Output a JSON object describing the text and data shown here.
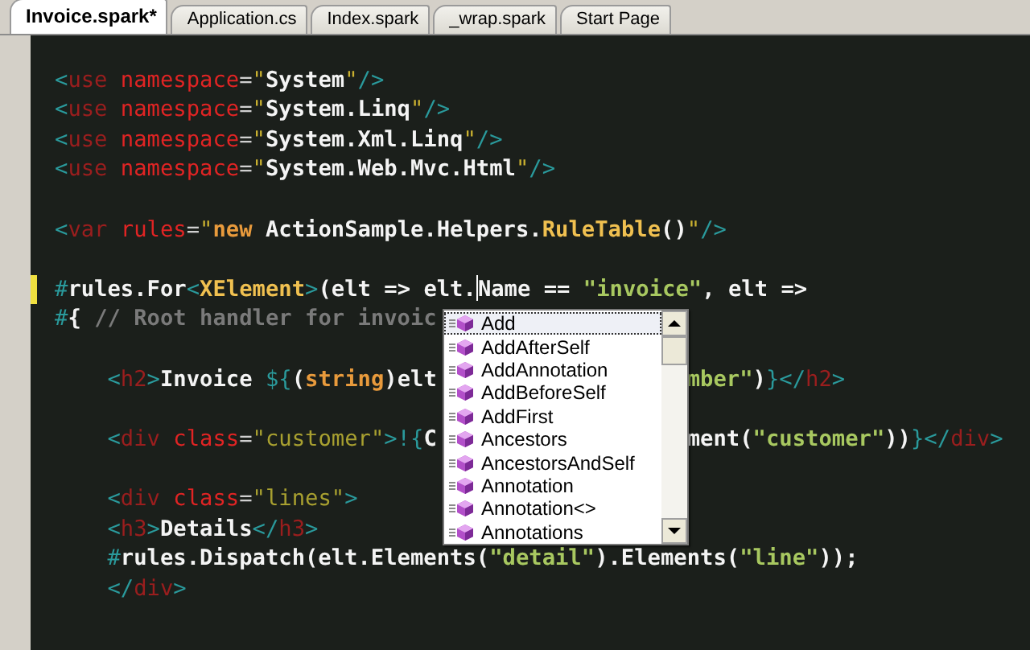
{
  "tabs": [
    {
      "label": "Invoice.spark*",
      "selected": true
    },
    {
      "label": "Application.cs",
      "selected": false
    },
    {
      "label": "Index.spark",
      "selected": false
    },
    {
      "label": "_wrap.spark",
      "selected": false
    },
    {
      "label": "Start Page",
      "selected": false
    }
  ],
  "editor": {
    "blocks": [
      [
        {
          "tokens": [
            {
              "kind": "punct",
              "text": "<"
            },
            {
              "kind": "tag",
              "text": "use"
            },
            {
              "kind": "attr",
              "text": " namespace"
            },
            {
              "kind": "op",
              "text": "="
            },
            {
              "kind": "quote",
              "text": "\""
            },
            {
              "kind": "text",
              "text": "System"
            },
            {
              "kind": "quote",
              "text": "\""
            },
            {
              "kind": "punct",
              "text": "/>"
            }
          ]
        },
        {
          "tokens": [
            {
              "kind": "punct",
              "text": "<"
            },
            {
              "kind": "tag",
              "text": "use"
            },
            {
              "kind": "attr",
              "text": " namespace"
            },
            {
              "kind": "op",
              "text": "="
            },
            {
              "kind": "quote",
              "text": "\""
            },
            {
              "kind": "text",
              "text": "System.Linq"
            },
            {
              "kind": "quote",
              "text": "\""
            },
            {
              "kind": "punct",
              "text": "/>"
            }
          ]
        },
        {
          "tokens": [
            {
              "kind": "punct",
              "text": "<"
            },
            {
              "kind": "tag",
              "text": "use"
            },
            {
              "kind": "attr",
              "text": " namespace"
            },
            {
              "kind": "op",
              "text": "="
            },
            {
              "kind": "quote",
              "text": "\""
            },
            {
              "kind": "text",
              "text": "System.Xml.Linq"
            },
            {
              "kind": "quote",
              "text": "\""
            },
            {
              "kind": "punct",
              "text": "/>"
            }
          ]
        },
        {
          "tokens": [
            {
              "kind": "punct",
              "text": "<"
            },
            {
              "kind": "tag",
              "text": "use"
            },
            {
              "kind": "attr",
              "text": " namespace"
            },
            {
              "kind": "op",
              "text": "="
            },
            {
              "kind": "quote",
              "text": "\""
            },
            {
              "kind": "text",
              "text": "System.Web.Mvc.Html"
            },
            {
              "kind": "quote",
              "text": "\""
            },
            {
              "kind": "punct",
              "text": "/>"
            }
          ]
        }
      ],
      [
        {
          "tokens": [
            {
              "kind": "punct",
              "text": "<"
            },
            {
              "kind": "tag",
              "text": "var"
            },
            {
              "kind": "attr",
              "text": " rules"
            },
            {
              "kind": "op",
              "text": "="
            },
            {
              "kind": "quote",
              "text": "\""
            },
            {
              "kind": "keyword",
              "text": "new"
            },
            {
              "kind": "text",
              "text": " ActionSample.Helpers."
            },
            {
              "kind": "type",
              "text": "RuleTable"
            },
            {
              "kind": "text",
              "text": "()"
            },
            {
              "kind": "quote",
              "text": "\""
            },
            {
              "kind": "punct",
              "text": "/>"
            }
          ]
        }
      ],
      [
        {
          "modified": true,
          "tokens": [
            {
              "kind": "punct",
              "text": "#"
            },
            {
              "kind": "text",
              "text": "rules.For"
            },
            {
              "kind": "punct",
              "text": "<"
            },
            {
              "kind": "type",
              "text": "XElement"
            },
            {
              "kind": "punct",
              "text": ">"
            },
            {
              "kind": "text",
              "text": "(elt => elt."
            },
            {
              "kind": "caret"
            },
            {
              "kind": "text",
              "text": "Name == "
            },
            {
              "kind": "string",
              "text": "\"invoice\""
            },
            {
              "kind": "text",
              "text": ", elt =>"
            }
          ]
        },
        {
          "tokens": [
            {
              "kind": "punct",
              "text": "#"
            },
            {
              "kind": "text",
              "text": "{ "
            },
            {
              "kind": "comment",
              "text": "// Root handler for invoic"
            }
          ]
        }
      ],
      [
        {
          "indent": true,
          "tokens": [
            {
              "kind": "punct",
              "text": "<"
            },
            {
              "kind": "tag",
              "text": "h2"
            },
            {
              "kind": "punct",
              "text": ">"
            },
            {
              "kind": "text",
              "text": "Invoice "
            },
            {
              "kind": "punct",
              "text": "${"
            },
            {
              "kind": "text",
              "text": "("
            },
            {
              "kind": "keyword",
              "text": "string"
            },
            {
              "kind": "text",
              "text": ")elt"
            }
          ],
          "after_popup": [
            {
              "kind": "string",
              "text": "mber\""
            },
            {
              "kind": "text",
              "text": ")"
            },
            {
              "kind": "punct",
              "text": "}</"
            },
            {
              "kind": "tag",
              "text": "h2"
            },
            {
              "kind": "punct",
              "text": ">"
            }
          ]
        }
      ],
      [
        {
          "indent": true,
          "tokens": [
            {
              "kind": "punct",
              "text": "<"
            },
            {
              "kind": "tag",
              "text": "div"
            },
            {
              "kind": "attr",
              "text": " class"
            },
            {
              "kind": "op",
              "text": "="
            },
            {
              "kind": "value",
              "text": "\"customer\""
            },
            {
              "kind": "punct",
              "text": ">!{"
            },
            {
              "kind": "text",
              "text": "C"
            }
          ],
          "after_popup": [
            {
              "kind": "text",
              "text": "ment("
            },
            {
              "kind": "string",
              "text": "\"customer\""
            },
            {
              "kind": "text",
              "text": "))"
            },
            {
              "kind": "punct",
              "text": "}</"
            },
            {
              "kind": "tag",
              "text": "div"
            },
            {
              "kind": "punct",
              "text": ">"
            }
          ]
        }
      ],
      [
        {
          "indent": true,
          "tokens": [
            {
              "kind": "punct",
              "text": "<"
            },
            {
              "kind": "tag",
              "text": "div"
            },
            {
              "kind": "attr",
              "text": " class"
            },
            {
              "kind": "op",
              "text": "="
            },
            {
              "kind": "value",
              "text": "\"lines\""
            },
            {
              "kind": "punct",
              "text": ">"
            }
          ]
        },
        {
          "indent": true,
          "tokens": [
            {
              "kind": "punct",
              "text": "<"
            },
            {
              "kind": "tag",
              "text": "h3"
            },
            {
              "kind": "punct",
              "text": ">"
            },
            {
              "kind": "text",
              "text": "Details"
            },
            {
              "kind": "punct",
              "text": "</"
            },
            {
              "kind": "tag",
              "text": "h3"
            },
            {
              "kind": "punct",
              "text": ">"
            }
          ]
        },
        {
          "indent": true,
          "tokens": [
            {
              "kind": "punct",
              "text": "#"
            },
            {
              "kind": "text",
              "text": "rules.Dispatch(elt.Elements("
            },
            {
              "kind": "string",
              "text": "\"detail\""
            },
            {
              "kind": "text",
              "text": ").Elements("
            },
            {
              "kind": "string",
              "text": "\"line\""
            },
            {
              "kind": "text",
              "text": "));"
            }
          ]
        },
        {
          "indent": true,
          "tokens": [
            {
              "kind": "punct",
              "text": "</"
            },
            {
              "kind": "tag",
              "text": "div"
            },
            {
              "kind": "punct",
              "text": ">"
            }
          ]
        }
      ]
    ]
  },
  "completion": {
    "items": [
      {
        "label": "Add",
        "selected": true
      },
      {
        "label": "AddAfterSelf",
        "selected": false
      },
      {
        "label": "AddAnnotation",
        "selected": false
      },
      {
        "label": "AddBeforeSelf",
        "selected": false
      },
      {
        "label": "AddFirst",
        "selected": false
      },
      {
        "label": "Ancestors",
        "selected": false
      },
      {
        "label": "AncestorsAndSelf",
        "selected": false
      },
      {
        "label": "Annotation",
        "selected": false
      },
      {
        "label": "Annotation<>",
        "selected": false
      },
      {
        "label": "Annotations",
        "selected": false
      }
    ]
  }
}
